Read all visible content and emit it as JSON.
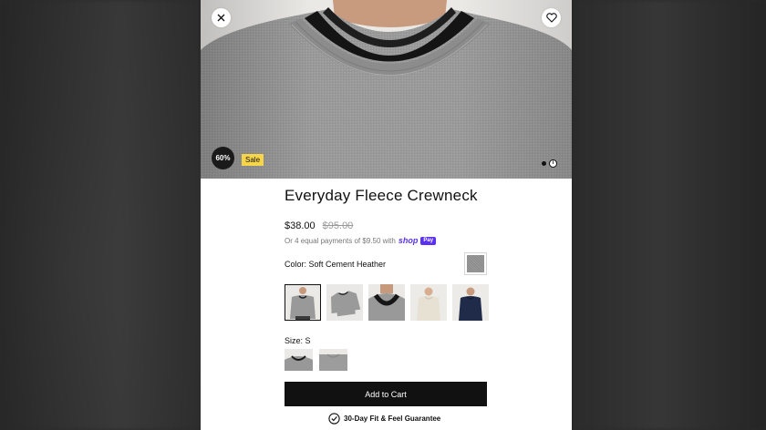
{
  "product": {
    "title": "Everyday Fleece Crewneck",
    "price_now": "$38.00",
    "price_was": "$95.00",
    "installments_text": "Or 4 equal payments of $9.50 with",
    "shop_logo": "shop",
    "shop_pay_pill": "Pay"
  },
  "hero": {
    "discount_badge": "60%",
    "sale_badge": "Sale",
    "info_label": "i"
  },
  "color": {
    "label": "Color: Soft Cement Heather",
    "swatch_color": "#909090"
  },
  "variants": [
    {
      "name": "grey-crewneck-front",
      "selected": true
    },
    {
      "name": "grey-crewneck-flat",
      "selected": false
    },
    {
      "name": "grey-crewneck-closeup",
      "selected": false
    },
    {
      "name": "cream-crewneck",
      "selected": false
    },
    {
      "name": "navy-crewneck",
      "selected": false
    }
  ],
  "size": {
    "label": "Size: S"
  },
  "actions": {
    "add_to_cart": "Add to Cart"
  },
  "guarantee": {
    "text": "30-Day Fit & Feel Guarantee",
    "icon": "check-badge-icon"
  },
  "icons": {
    "close": "close-icon",
    "favorite": "heart-icon"
  },
  "colors": {
    "shop_pay": "#5a31f4",
    "sale_badge": "#f7d54a",
    "cta": "#111111"
  }
}
